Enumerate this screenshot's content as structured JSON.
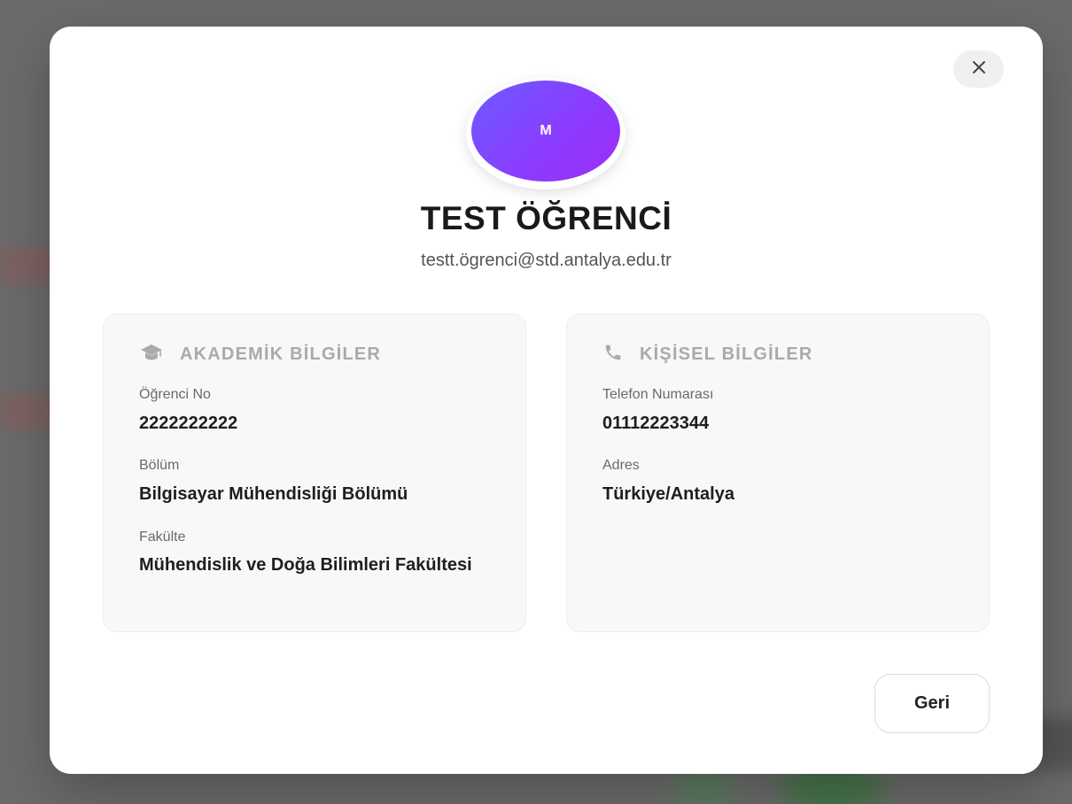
{
  "student": {
    "avatar_initial": "M",
    "name": "TEST ÖĞRENCİ",
    "email": "testt.ögrenci@std.antalya.edu.tr"
  },
  "academic": {
    "icon": "graduation-cap-icon",
    "title": "AKADEMİK BİLGİLER",
    "student_no_label": "Öğrenci No",
    "student_no": "2222222222",
    "department_label": "Bölüm",
    "department": "Bilgisayar Mühendisliği Bölümü",
    "faculty_label": "Fakülte",
    "faculty": "Mühendislik ve Doğa Bilimleri Fakültesi"
  },
  "personal": {
    "icon": "phone-icon",
    "title": "KİŞİSEL BİLGİLER",
    "phone_label": "Telefon Numarası",
    "phone": "01112223344",
    "address_label": "Adres",
    "address": "Türkiye/Antalya"
  },
  "actions": {
    "close_icon": "close-icon",
    "back_label": "Geri"
  },
  "colors": {
    "avatar_gradient_start": "#6b5bff",
    "avatar_gradient_end": "#9b2df7",
    "card_background": "#f8f8f8",
    "section_title": "#aaaaaa"
  }
}
